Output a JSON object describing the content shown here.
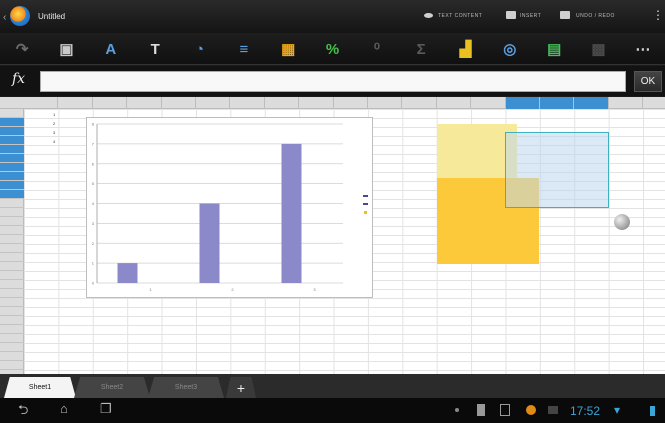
{
  "title_bar": {
    "app_title": "Untitled",
    "actions": [
      "TEXT CONTENT",
      "INSERT",
      "UNDO / REDO"
    ]
  },
  "toolbar": {
    "tools": [
      {
        "name": "redo-icon",
        "glyph": "↷",
        "color": "#6a6a6a"
      },
      {
        "name": "paste-icon",
        "glyph": "▣",
        "color": "#c9c9c9"
      },
      {
        "name": "font-size-icon",
        "glyph": "A",
        "color": "#5aa0e0"
      },
      {
        "name": "italic-text-icon",
        "glyph": "T",
        "color": "#ddd"
      },
      {
        "name": "fill-color-icon",
        "glyph": "◔",
        "color": "#5aa0e0"
      },
      {
        "name": "align-icon",
        "glyph": "≡",
        "color": "#5aa0e0"
      },
      {
        "name": "cell-format-icon",
        "glyph": "▦",
        "color": "#f0a818"
      },
      {
        "name": "percent-icon",
        "glyph": "%",
        "color": "#45c24a"
      },
      {
        "name": "decimal-icon",
        "glyph": "⁰",
        "color": "#5a5a5a"
      },
      {
        "name": "sum-icon",
        "glyph": "Σ",
        "color": "#5a5a5a"
      },
      {
        "name": "chart-icon",
        "glyph": "▟",
        "color": "#e8c020"
      },
      {
        "name": "find-icon",
        "glyph": "◎",
        "color": "#5aa0e0"
      },
      {
        "name": "table-icon",
        "glyph": "▤",
        "color": "#46c05a"
      },
      {
        "name": "freeze-icon",
        "glyph": "▩",
        "color": "#4a4a4a"
      },
      {
        "name": "more-icon",
        "glyph": "⋯",
        "color": "#cfcfcf"
      }
    ]
  },
  "formula_bar": {
    "fx": "fx",
    "value": "",
    "ok_label": "OK"
  },
  "sheet": {
    "cells": [
      "1",
      "2",
      "3",
      "4"
    ],
    "chart_data": {
      "type": "bar",
      "categories": [
        "1",
        "2",
        "3"
      ],
      "values": [
        1,
        4,
        7
      ],
      "ylim": [
        0,
        8
      ],
      "grid": true,
      "y_ticks": [
        "0",
        "1",
        "2",
        "3",
        "4",
        "5",
        "6",
        "7",
        "8"
      ],
      "legend": "right",
      "bar_color": "#8b89c9"
    }
  },
  "tabs": {
    "sheets": [
      "Sheet1",
      "Sheet2",
      "Sheet3"
    ],
    "active": 0,
    "add_label": "+"
  },
  "status": {
    "time": "17:52"
  }
}
